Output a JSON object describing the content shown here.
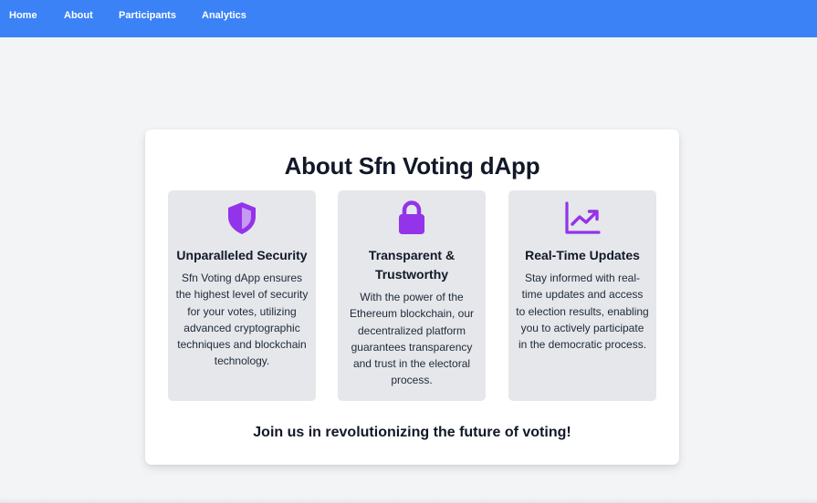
{
  "nav": {
    "items": [
      {
        "label": "Home"
      },
      {
        "label": "About"
      },
      {
        "label": "Participants"
      },
      {
        "label": "Analytics"
      }
    ]
  },
  "about": {
    "title": "About Sfn Voting dApp",
    "features": [
      {
        "icon": "shield-icon",
        "title": "Unparalleled Security",
        "text": "Sfn Voting dApp ensures the highest level of security for your votes, utilizing advanced cryptographic techniques and blockchain technology."
      },
      {
        "icon": "lock-icon",
        "title": "Transparent & Trustworthy",
        "text": "With the power of the Ethereum blockchain, our decentralized platform guarantees transparency and trust in the electoral process."
      },
      {
        "icon": "trending-chart-icon",
        "title": "Real-Time Updates",
        "text": "Stay informed with real-time updates and access to election results, enabling you to actively participate in the democratic process."
      }
    ],
    "tagline": "Join us in revolutionizing the future of voting!"
  },
  "colors": {
    "navbar": "#3b82f6",
    "icon_accent": "#9333ea",
    "background": "#f3f4f6",
    "feature_bg": "#e5e7eb"
  }
}
